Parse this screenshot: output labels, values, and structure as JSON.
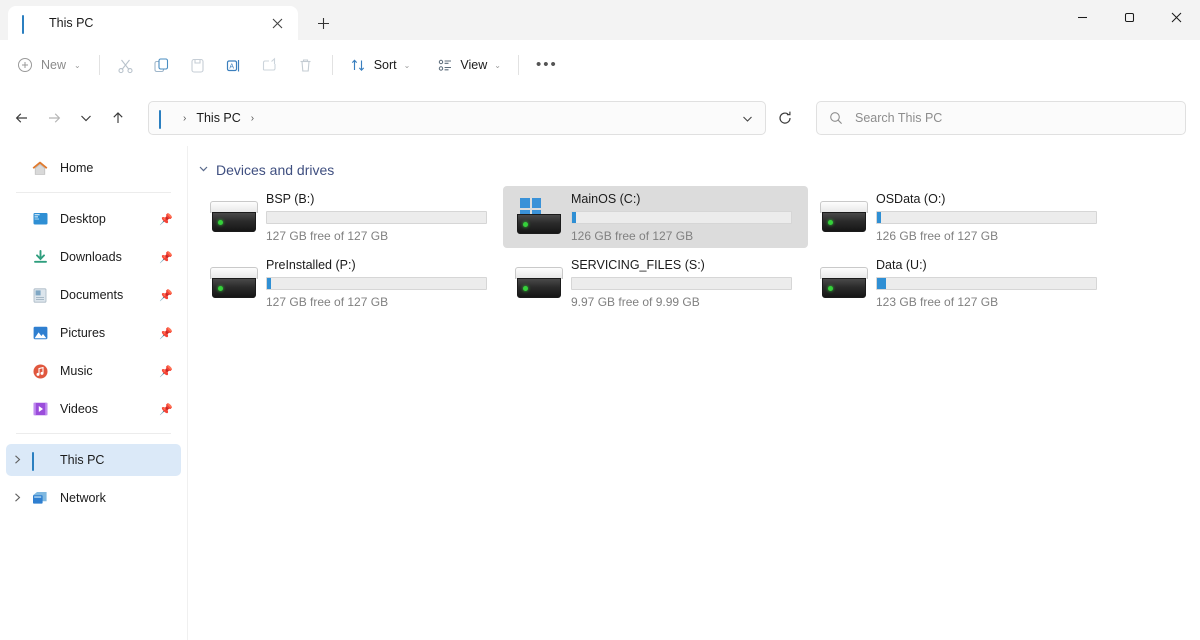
{
  "window": {
    "tab_title": "This PC",
    "tab_close": "✕",
    "new_tab": "+",
    "minimize": "minimize-icon",
    "maximize": "maximize-icon",
    "close": "close-icon"
  },
  "toolbar": {
    "new_label": "New",
    "new_chevron": "⌄",
    "cut_label": "Cut",
    "copy_label": "Copy",
    "paste_label": "Paste",
    "rename_label": "Rename",
    "share_label": "Share",
    "delete_label": "Delete",
    "sort_label": "Sort",
    "sort_chevron": "⌄",
    "view_label": "View",
    "view_chevron": "⌄",
    "more_label": "See more"
  },
  "navbar": {
    "back": "←",
    "forward": "→",
    "recent_chevron": "⌄",
    "up": "↑",
    "breadcrumb": [
      "This PC"
    ],
    "breadcrumb_sep": "›",
    "address_chevron": "⌄",
    "refresh": "refresh-icon",
    "search_placeholder": "Search This PC"
  },
  "sidebar": {
    "items": [
      {
        "label": "Home",
        "icon": "home-icon",
        "expander": "",
        "pin": "",
        "selected": false
      },
      {
        "label": "Desktop",
        "icon": "desktop-icon",
        "expander": "",
        "pin": "📌",
        "selected": false
      },
      {
        "label": "Downloads",
        "icon": "downloads-icon",
        "expander": "",
        "pin": "📌",
        "selected": false
      },
      {
        "label": "Documents",
        "icon": "documents-icon",
        "expander": "",
        "pin": "📌",
        "selected": false
      },
      {
        "label": "Pictures",
        "icon": "pictures-icon",
        "expander": "",
        "pin": "📌",
        "selected": false
      },
      {
        "label": "Music",
        "icon": "music-icon",
        "expander": "",
        "pin": "📌",
        "selected": false
      },
      {
        "label": "Videos",
        "icon": "videos-icon",
        "expander": "",
        "pin": "📌",
        "selected": false
      },
      {
        "label": "This PC",
        "icon": "thispc-icon",
        "expander": "›",
        "pin": "",
        "selected": true
      },
      {
        "label": "Network",
        "icon": "network-icon",
        "expander": "›",
        "pin": "",
        "selected": false
      }
    ]
  },
  "content": {
    "group_title": "Devices and drives",
    "group_chevron": "⌄",
    "drives": [
      {
        "name": "BSP (B:)",
        "free_text": "127 GB free of 127 GB",
        "used_percent": 0,
        "selected": false,
        "windows_badge": false
      },
      {
        "name": "MainOS (C:)",
        "free_text": "126 GB free of 127 GB",
        "used_percent": 2,
        "selected": true,
        "windows_badge": true
      },
      {
        "name": "OSData (O:)",
        "free_text": "126 GB free of 127 GB",
        "used_percent": 2,
        "selected": false,
        "windows_badge": false
      },
      {
        "name": "PreInstalled (P:)",
        "free_text": "127 GB free of 127 GB",
        "used_percent": 2,
        "selected": false,
        "windows_badge": false
      },
      {
        "name": "SERVICING_FILES (S:)",
        "free_text": "9.97 GB free of 9.99 GB",
        "used_percent": 0,
        "selected": false,
        "windows_badge": false
      },
      {
        "name": "Data (U:)",
        "free_text": "123 GB free of 127 GB",
        "used_percent": 4,
        "selected": false,
        "windows_badge": false
      }
    ]
  },
  "colors": {
    "accent": "#2f8fd4",
    "selection_blue": "#dbe9f8",
    "selection_gray": "#dcdcdc",
    "group_title": "#3f4f80"
  }
}
